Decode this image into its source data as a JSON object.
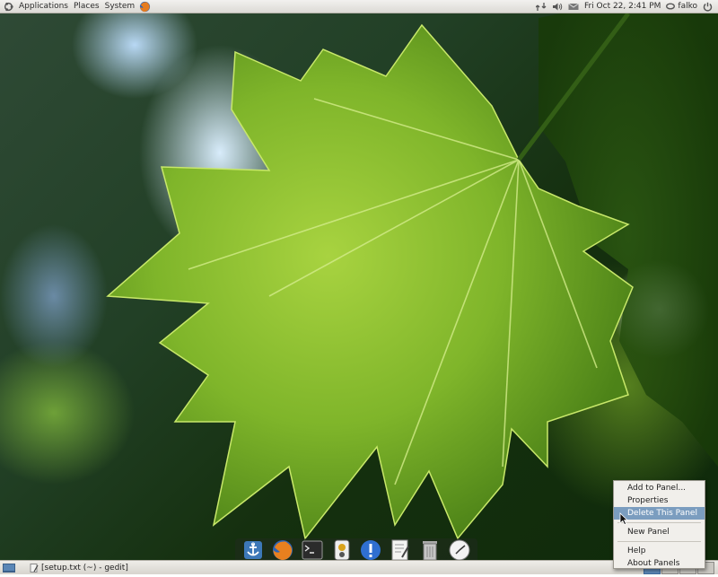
{
  "top_panel": {
    "menus": [
      "Applications",
      "Places",
      "System"
    ],
    "clock": "Fri Oct 22,  2:41 PM",
    "user": "falko",
    "tray_icons": [
      "network-icon",
      "volume-icon",
      "mail-icon"
    ]
  },
  "bottom_panel": {
    "task": "[setup.txt (~) - gedit]",
    "workspaces": 4,
    "active_workspace": 1
  },
  "dock": {
    "items": [
      "anchor-icon",
      "firefox-icon",
      "terminal-icon",
      "media-player-icon",
      "info-icon",
      "text-editor-icon",
      "trash-icon",
      "clock-icon"
    ]
  },
  "context_menu": {
    "items": [
      "Add to Panel...",
      "Properties",
      "Delete This Panel",
      "New Panel",
      "Help",
      "About Panels"
    ],
    "highlighted": "Delete This Panel"
  },
  "colors": {
    "leaf": "#7cb82a",
    "highlight": "#7b9dbf",
    "panel": "#e6e4df"
  }
}
